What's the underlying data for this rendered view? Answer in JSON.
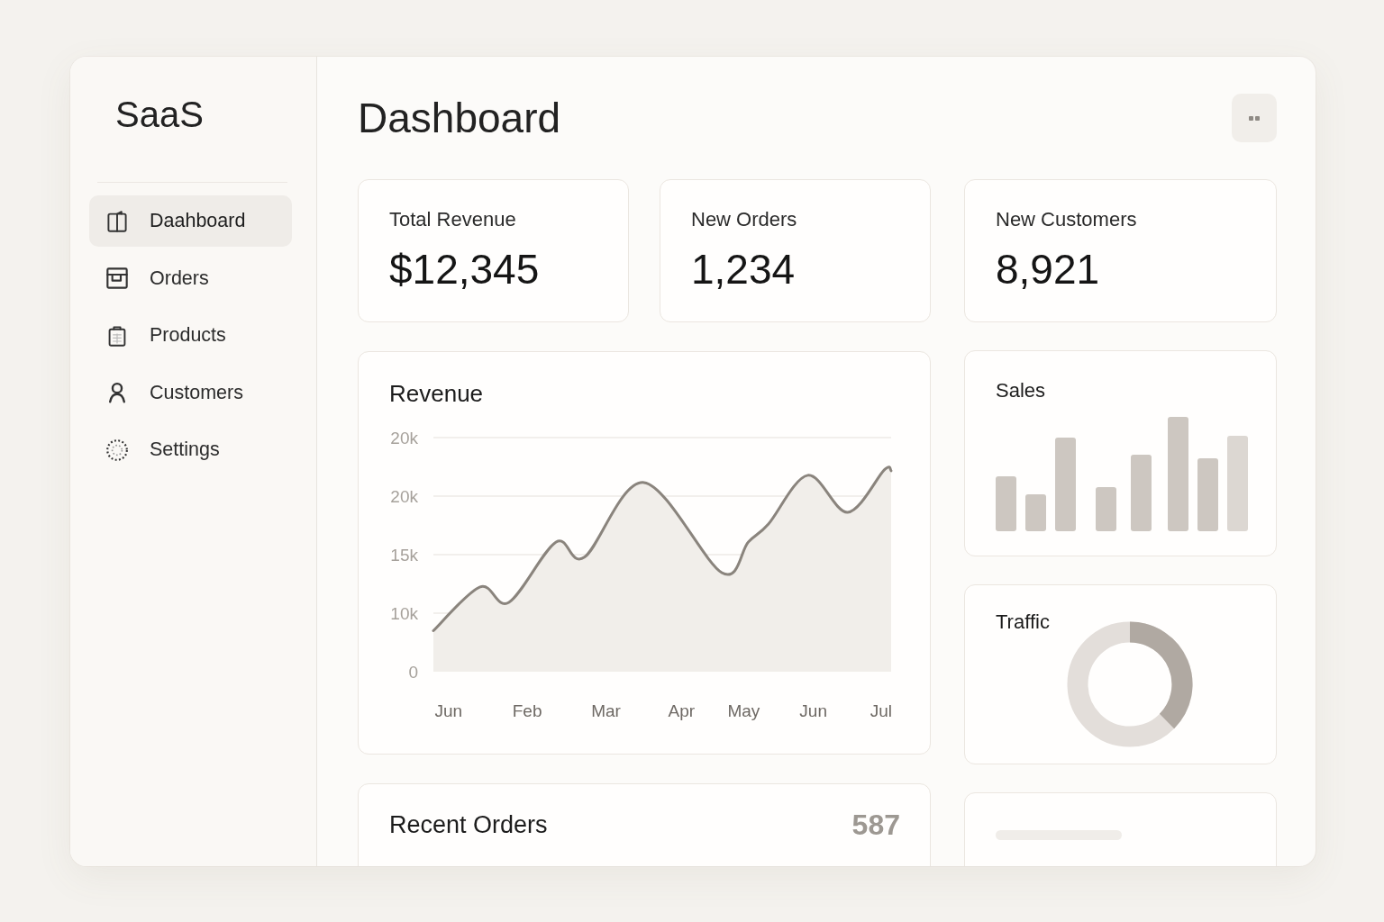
{
  "sidebar": {
    "logo": "SaaS",
    "nav": [
      {
        "label": "Daahboard",
        "selected": true
      },
      {
        "label": "Orders",
        "selected": false
      },
      {
        "label": "Products",
        "selected": false
      },
      {
        "label": "Customers",
        "selected": false
      },
      {
        "label": "Settings",
        "selected": false
      }
    ]
  },
  "header": {
    "title": "Dashboard"
  },
  "stats": [
    {
      "label": "Total Revenue",
      "value": "$12,345"
    },
    {
      "label": "New Orders",
      "value": "1,234"
    },
    {
      "label": "New Customers",
      "value": "8,921"
    }
  ],
  "revenue": {
    "title": "Revenue",
    "y_axis_labels": [
      "20k",
      "20k",
      "15k",
      "10k",
      "0"
    ],
    "x_axis_labels": [
      "Jun",
      "Feb",
      "Mar",
      "Apr",
      "May",
      "Jun",
      "Jul"
    ]
  },
  "sales": {
    "title": "Sales"
  },
  "traffic": {
    "title": "Traffic"
  },
  "recent_orders": {
    "title": "Recent Orders",
    "count": "587"
  }
}
